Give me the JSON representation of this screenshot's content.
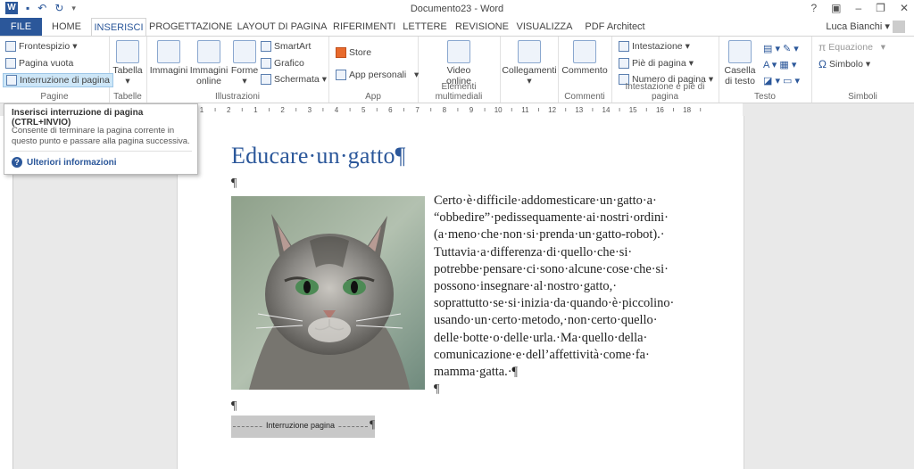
{
  "window": {
    "title": "Documento23 - Word",
    "help": "?",
    "user": "Luca Bianchi"
  },
  "tabs": [
    "FILE",
    "HOME",
    "INSERISCI",
    "PROGETTAZIONE",
    "LAYOUT DI PAGINA",
    "RIFERIMENTI",
    "LETTERE",
    "REVISIONE",
    "VISUALIZZA",
    "PDF Architect"
  ],
  "ribbon": {
    "pagine": {
      "label": "Pagine",
      "frontespizio": "Frontespizio",
      "pagina_vuota": "Pagina vuota",
      "interruzione": "Interruzione di pagina"
    },
    "tabelle": {
      "label": "Tabelle",
      "tabella": "Tabella"
    },
    "illustrazioni": {
      "label": "Illustrazioni",
      "immagini": "Immagini",
      "immagini_online": "Immagini online",
      "forme": "Forme",
      "smartart": "SmartArt",
      "grafico": "Grafico",
      "schermata": "Schermata"
    },
    "app": {
      "label": "App",
      "store": "Store",
      "app_personali": "App personali"
    },
    "multimediali": {
      "label": "Elementi multimediali",
      "video_online": "Video online"
    },
    "collegamenti": {
      "label": "",
      "collegamenti": "Collegamenti"
    },
    "commenti": {
      "label": "Commenti",
      "commento": "Commento"
    },
    "intestazione": {
      "label": "Intestazione e piè di pagina",
      "intestazione": "Intestazione",
      "pie": "Piè di pagina",
      "numero": "Numero di pagina"
    },
    "testo": {
      "label": "Testo",
      "casella": "Casella di testo"
    },
    "simboli": {
      "label": "Simboli",
      "equazione": "Equazione",
      "simbolo": "Simbolo"
    }
  },
  "tooltip": {
    "title": "Inserisci interruzione di pagina (CTRL+INVIO)",
    "description": "Consente di terminare la pagina corrente in questo punto e passare alla pagina successiva.",
    "help_link": "Ulteriori informazioni"
  },
  "ruler": {
    "ticks": [
      "1",
      "2",
      "1",
      "2",
      "3",
      "4",
      "5",
      "6",
      "7",
      "8",
      "9",
      "10",
      "11",
      "12",
      "13",
      "14",
      "15",
      "16",
      "18"
    ]
  },
  "document": {
    "title": "Educare·un·gatto¶",
    "pilcrow": "¶",
    "paragraph_lines": [
      "Certo·è·difficile·addomesticare·un·gatto·a·",
      "“obbedire”·pedissequamente·ai·nostri·ordini·",
      "(a·meno·che·non·si·prenda·un·gatto-robot).·",
      "Tuttavia·a·differenza·di·quello·che·si·",
      "potrebbe·pensare·ci·sono·alcune·cose·che·si·",
      "possono·insegnare·al·nostro·gatto,·",
      "soprattutto·se·si·inizia·da·quando·è·piccolino·",
      "usando·un·certo·metodo,·non·certo·quello·",
      "delle·botte·o·delle·urla.·Ma·quello·della·",
      "comunicazione·e·dell’affettività·come·fa·",
      "mamma·gatta.·¶"
    ],
    "page_break_label": "Interruzione pagina"
  }
}
